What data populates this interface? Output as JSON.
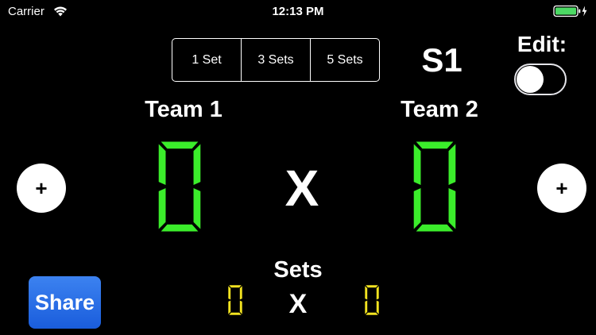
{
  "status_bar": {
    "carrier": "Carrier",
    "time": "12:13 PM",
    "wifi_icon": "wifi-icon",
    "battery_icon": "battery-charging-icon",
    "battery_color": "#4cd964"
  },
  "set_selector": {
    "options": [
      "1 Set",
      "3 Sets",
      "5 Sets"
    ]
  },
  "current_set": "S1",
  "edit": {
    "label": "Edit:",
    "enabled": false
  },
  "teams": [
    {
      "name": "Team 1",
      "score": 0,
      "sets": 0
    },
    {
      "name": "Team 2",
      "score": 0,
      "sets": 0
    }
  ],
  "versus": "X",
  "sets_section": {
    "label": "Sets",
    "versus": "X"
  },
  "add_point_label": "+",
  "share_label": "Share",
  "colors": {
    "score_digit": "#3bed2b",
    "sets_digit": "#f2e320",
    "share_button": "#2a6fe6"
  }
}
